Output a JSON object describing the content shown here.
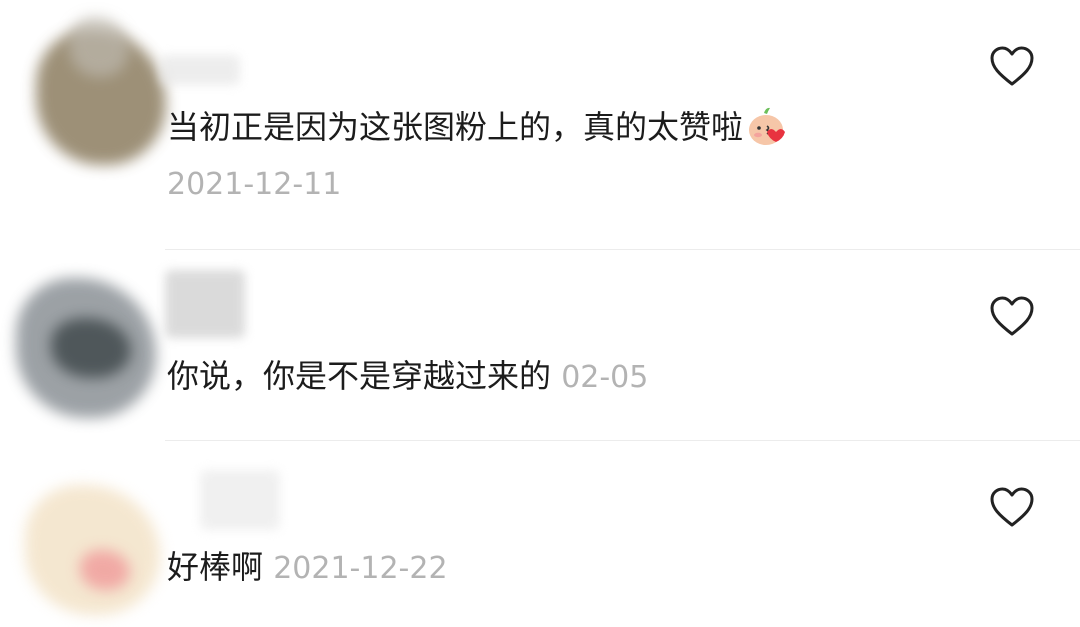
{
  "comments": [
    {
      "text": "当初正是因为这张图粉上的，真的太赞啦",
      "emoji": "blushing-peach-emoji",
      "date": "2021-12-11",
      "like_icon": "heart-outline-icon"
    },
    {
      "text": "你说，你是不是穿越过来的",
      "date": "02-05",
      "like_icon": "heart-outline-icon"
    },
    {
      "text": "好棒啊",
      "date": "2021-12-22",
      "like_icon": "heart-outline-icon"
    }
  ],
  "colors": {
    "date": "#b3b3b3",
    "text": "#1c1c1c",
    "divider": "#ececec",
    "heart_stroke": "#222222"
  }
}
